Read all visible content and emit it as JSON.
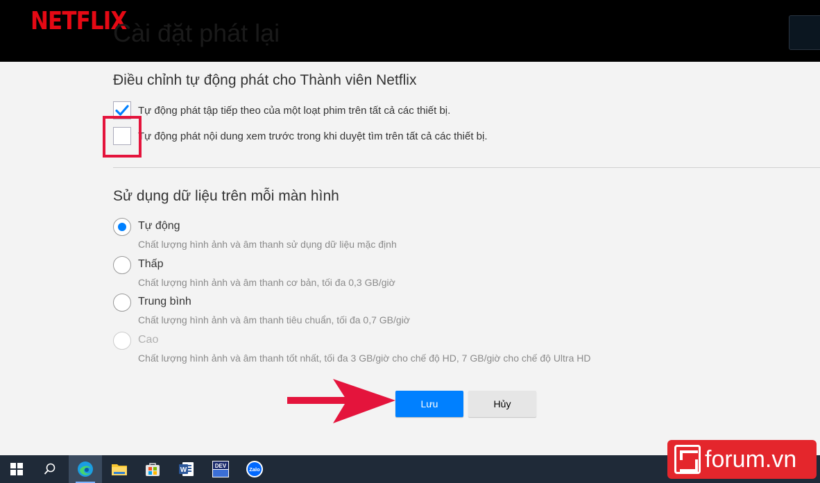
{
  "header": {
    "logo": "NETFLIX",
    "page_title": "Cài đặt phát lại"
  },
  "autoplay": {
    "title": "Điều chỉnh tự động phát cho Thành viên Netflix",
    "options": [
      {
        "label": "Tự động phát tập tiếp theo của một loạt phim trên tất cả các thiết bị.",
        "checked": true
      },
      {
        "label": "Tự động phát nội dung xem trước trong khi duyệt tìm trên tất cả các thiết bị.",
        "checked": false
      }
    ]
  },
  "data_usage": {
    "title": "Sử dụng dữ liệu trên mỗi màn hình",
    "options": [
      {
        "label": "Tự động",
        "desc": "Chất lượng hình ảnh và âm thanh sử dụng dữ liệu mặc định",
        "selected": true,
        "disabled": false
      },
      {
        "label": "Thấp",
        "desc": "Chất lượng hình ảnh và âm thanh cơ bản, tối đa 0,3 GB/giờ",
        "selected": false,
        "disabled": false
      },
      {
        "label": "Trung bình",
        "desc": "Chất lượng hình ảnh và âm thanh tiêu chuẩn, tối đa 0,7 GB/giờ",
        "selected": false,
        "disabled": false
      },
      {
        "label": "Cao",
        "desc": "Chất lượng hình ảnh và âm thanh tốt nhất, tối đa 3 GB/giờ cho chế độ HD, 7 GB/giờ cho chế độ Ultra HD",
        "selected": false,
        "disabled": true
      }
    ]
  },
  "buttons": {
    "save": "Lưu",
    "cancel": "Hủy"
  },
  "taskbar": {
    "dev_label": "DEV",
    "zalo_label": "Zalo",
    "word_label": "W"
  },
  "watermark": "forum.vn",
  "colors": {
    "netflix_red": "#e50914",
    "accent_blue": "#0080ff",
    "highlight_red": "#e4143c"
  }
}
